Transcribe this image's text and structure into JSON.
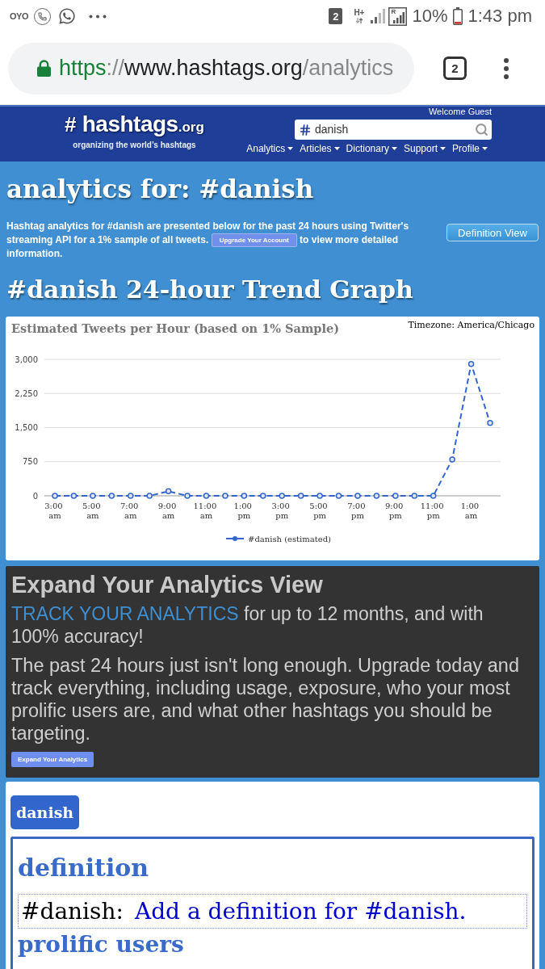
{
  "status_bar": {
    "carrier_logo": "OYO",
    "sim_slot": "2",
    "network_type": "H+",
    "roaming_label": "R",
    "battery": "10%",
    "time": "1:43 pm"
  },
  "browser": {
    "url": {
      "scheme": "https",
      "separator": "://",
      "host": "www.hashtags.org",
      "path": "/analytics"
    },
    "tab_count": "2"
  },
  "header": {
    "welcome": "Welcome Guest",
    "logo": {
      "hash": "#",
      "name": "hashtags",
      "tld": ".org",
      "tagline": "organizing the world’s hashtags"
    },
    "search": {
      "value": "danish"
    },
    "nav": [
      {
        "label": "Analytics"
      },
      {
        "label": "Articles"
      },
      {
        "label": "Dictionary"
      },
      {
        "label": "Support"
      },
      {
        "label": "Profile"
      }
    ]
  },
  "intro": {
    "title": "analytics for: #danish",
    "description_before": "Hashtag analytics for #danish are presented below for the past 24 hours using Twitter's streaming API for a 1% sample of all tweets.",
    "upgrade_button": "Upgrade Your Account",
    "description_after": "to view more detailed information.",
    "definition_view_button": "Definition View"
  },
  "trend": {
    "title": "#danish 24-hour Trend Graph",
    "timezone": "Timezone: America/Chicago",
    "chart_data": {
      "type": "line",
      "title": "Estimated Tweets per Hour (based on 1% Sample)",
      "grid": true,
      "categories": [
        "3:00 am",
        null,
        "5:00 am",
        null,
        "7:00 am",
        null,
        "9:00 am",
        null,
        "11:00 am",
        null,
        "1:00 pm",
        null,
        "3:00 pm",
        null,
        "5:00 pm",
        null,
        "7:00 pm",
        null,
        "9:00 pm",
        null,
        "11:00 pm",
        null,
        "1:00 am",
        null
      ],
      "ylim": [
        0,
        3000
      ],
      "yticks": [
        {
          "value": 0,
          "label": "0"
        },
        {
          "value": 750,
          "label": "750"
        },
        {
          "value": 1500,
          "label": "1,500"
        },
        {
          "value": 2250,
          "label": "2,250"
        },
        {
          "value": 3000,
          "label": "3,000"
        }
      ],
      "series": [
        {
          "name": "#danish (estimated)",
          "color": "#3366cc",
          "line_style": "dashed",
          "marker": "circle",
          "values": [
            0,
            0,
            0,
            0,
            0,
            0,
            100,
            0,
            0,
            0,
            0,
            0,
            0,
            0,
            0,
            0,
            0,
            0,
            0,
            0,
            0,
            800,
            2900,
            1600
          ]
        }
      ]
    }
  },
  "promo": {
    "title": "Expand Your Analytics View",
    "highlight": "TRACK YOUR ANALYTICS",
    "tagline": "for up to 12 months, and with 100% accuracy!",
    "body": "The past 24 hours just isn't long enough. Upgrade today and track everything, including usage, exposure, who your most prolific users are, and what other hashtags you should be targeting.",
    "button": "Expand Your Analytics"
  },
  "tag": {
    "label": "danish",
    "definition_heading": "definition",
    "term": "#danish:",
    "add_link": "Add a definition for #danish.",
    "next_heading": "prolific users"
  }
}
